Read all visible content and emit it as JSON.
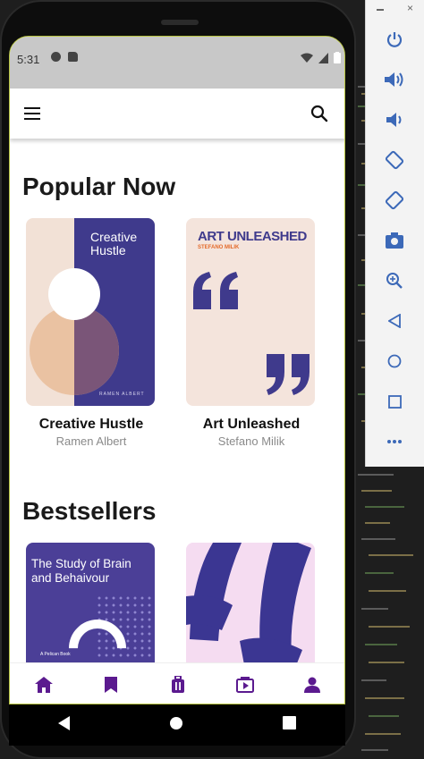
{
  "status_bar": {
    "time": "5:31"
  },
  "app_bar": {
    "menu_icon": "menu-icon",
    "search_icon": "search-icon"
  },
  "sections": [
    {
      "title": "Popular Now",
      "books": [
        {
          "title": "Creative Hustle",
          "author": "Ramen Albert",
          "cover_title": "Creative Hustle",
          "cover_author": "RAMEN ALBERT"
        },
        {
          "title": "Art Unleashed",
          "author": "Stefano Milik",
          "cover_title": "ART UNLEASHED",
          "cover_author": "STEFANO MILIK"
        }
      ]
    },
    {
      "title": "Bestsellers",
      "books": [
        {
          "cover_title": "The Study of Brain and Behaivour",
          "cover_subtitle": "A Pelican Book"
        },
        {
          "cover_title": ""
        }
      ]
    }
  ],
  "bottom_nav": [
    "home-icon",
    "bookmark-icon",
    "luggage-icon",
    "video-library-icon",
    "person-icon"
  ],
  "colors": {
    "accent": "#5b1a8f",
    "cover_navy": "#3f3a8c",
    "cover_peach": "#f3e3da",
    "cover_pink": "#f5dcf1"
  },
  "emulator_toolbar": [
    "power-icon",
    "volume-up-icon",
    "volume-down-icon",
    "rotate-left-icon",
    "rotate-right-icon",
    "camera-icon",
    "zoom-icon",
    "back-icon",
    "home-circle-icon",
    "overview-icon",
    "more-icon"
  ]
}
